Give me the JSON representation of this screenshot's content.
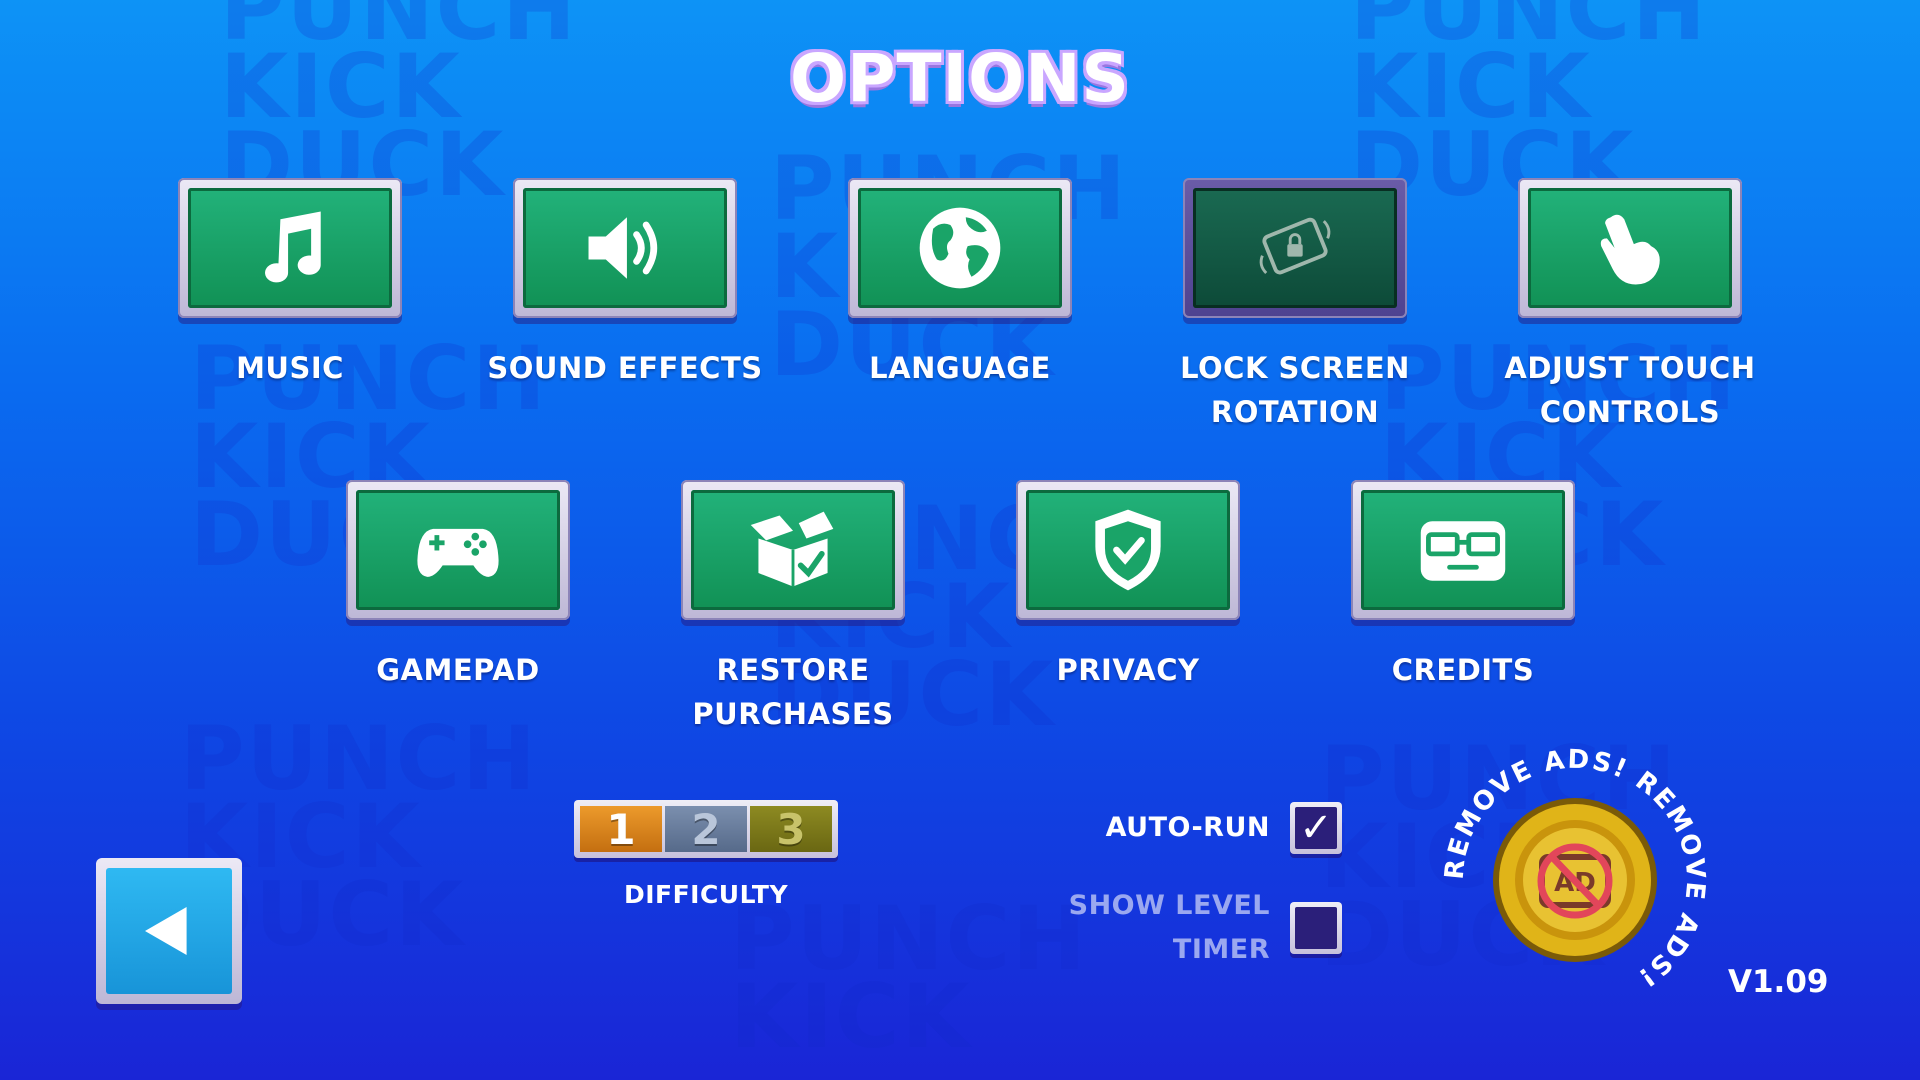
{
  "screen": {
    "title": "OPTIONS",
    "background_watermark": [
      "PUNCH",
      "KICK",
      "DUCK"
    ],
    "version": "V1.09"
  },
  "options_row1": [
    {
      "label": "MUSIC",
      "icon": "music-note-icon"
    },
    {
      "label": "SOUND EFFECTS",
      "icon": "speaker-icon"
    },
    {
      "label": "LANGUAGE",
      "icon": "globe-icon"
    },
    {
      "label_line1": "LOCK SCREEN",
      "label_line2": "ROTATION",
      "icon": "screen-rotation-lock-icon",
      "state": "active"
    },
    {
      "label_line1": "ADJUST TOUCH",
      "label_line2": "CONTROLS",
      "icon": "touch-hand-icon"
    }
  ],
  "options_row2": [
    {
      "label": "GAMEPAD",
      "icon": "gamepad-icon"
    },
    {
      "label_line1": "RESTORE",
      "label_line2": "PURCHASES",
      "icon": "box-check-icon"
    },
    {
      "label": "PRIVACY",
      "icon": "shield-check-icon"
    },
    {
      "label": "CREDITS",
      "icon": "glasses-face-icon"
    }
  ],
  "difficulty": {
    "label": "DIFFICULTY",
    "levels": [
      "1",
      "2",
      "3"
    ],
    "selected": "1"
  },
  "toggles": {
    "auto_run": {
      "label": "AUTO-RUN",
      "checked": true,
      "mark": "✓"
    },
    "show_level_timer": {
      "label_line1": "SHOW LEVEL",
      "label_line2": "TIMER",
      "checked": false
    }
  },
  "remove_ads": {
    "text": "REMOVE ADS! REMOVE ADS!",
    "icon": "no-ads-icon"
  },
  "back": {
    "icon": "back-arrow-icon"
  },
  "colors": {
    "button_green": "#1aa468",
    "background_blue": "#0a6cf0",
    "frame_lavender": "#d9d4ea",
    "gold": "#e0b418"
  }
}
